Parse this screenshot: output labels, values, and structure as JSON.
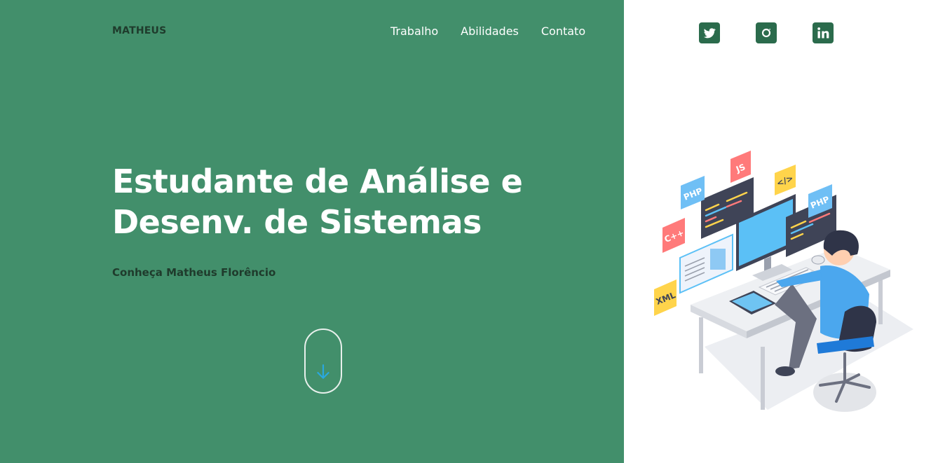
{
  "brand": "MATHEUS",
  "nav": [
    "Trabalho",
    "Abilidades",
    "Contato"
  ],
  "hero": {
    "title_line1": "Estudante de Análise e",
    "title_line2": "Desenv. de Sistemas",
    "subtitle": "Conheça Matheus Florêncio"
  },
  "social": [
    "twitter-icon",
    "instagram-icon",
    "linkedin-icon"
  ],
  "illustration": {
    "badges": [
      "PHP",
      "JS",
      "</>",
      "C++",
      "XML",
      "PHP"
    ]
  },
  "colors": {
    "left_bg": "#428f6b",
    "right_bg": "#ffffff",
    "brand_text": "#1f3b2c",
    "social_bg": "#2b6b4c",
    "scroll_arrow": "#29a8e0"
  }
}
